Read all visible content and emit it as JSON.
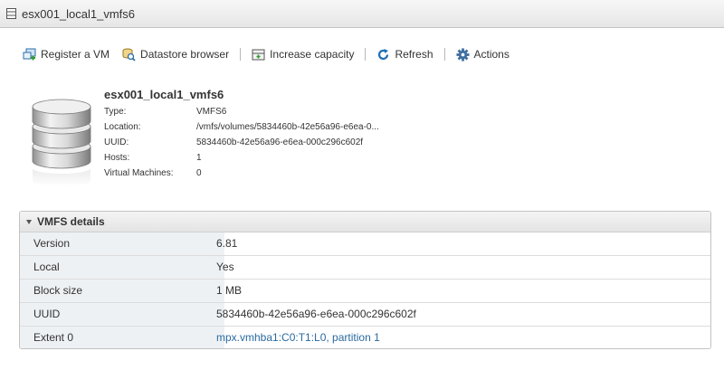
{
  "window": {
    "title": "esx001_local1_vmfs6"
  },
  "toolbar": {
    "register_vm": {
      "label": "Register a VM",
      "icon": "register-vm-icon"
    },
    "datastore_browser": {
      "label": "Datastore browser",
      "icon": "datastore-browser-icon"
    },
    "increase_capacity": {
      "label": "Increase capacity",
      "icon": "increase-capacity-icon"
    },
    "refresh": {
      "label": "Refresh",
      "icon": "refresh-icon"
    },
    "actions": {
      "label": "Actions",
      "icon": "gear-icon"
    }
  },
  "summary": {
    "name": "esx001_local1_vmfs6",
    "props": [
      {
        "label": "Type:",
        "value": "VMFS6"
      },
      {
        "label": "Location:",
        "value": "/vmfs/volumes/5834460b-42e56a96-e6ea-0..."
      },
      {
        "label": "UUID:",
        "value": "5834460b-42e56a96-e6ea-000c296c602f"
      },
      {
        "label": "Hosts:",
        "value": "1"
      },
      {
        "label": "Virtual Machines:",
        "value": "0"
      }
    ]
  },
  "vmfs_details": {
    "title": "VMFS details",
    "rows": [
      {
        "label": "Version",
        "value": "6.81"
      },
      {
        "label": "Local",
        "value": "Yes"
      },
      {
        "label": "Block size",
        "value": "1 MB"
      },
      {
        "label": "UUID",
        "value": "5834460b-42e56a96-e6ea-000c296c602f"
      },
      {
        "label": "Extent 0",
        "value": "mpx.vmhba1:C0:T1:L0, partition 1"
      }
    ]
  },
  "colors": {
    "link": "#2a6aa0",
    "label_bg": "#eef1f4",
    "accent_blue": "#1f6fb5"
  }
}
